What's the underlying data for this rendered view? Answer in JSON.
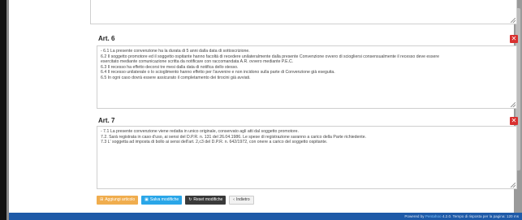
{
  "sections": [
    {
      "title": "Art. 6",
      "delete_icon": "close-icon",
      "lines": [
        "- 6.1 La presente convenzione ha la durata di 5 anni dalla data di sottoscrizione.",
        "6.2 Il soggetto promotore ed il soggetto ospitante hanno facoltà di recedere unilateralmente dalla presente Convenzione ovvero di sciogliersi consensualmente il recesso deve essere",
        "esercitato mediante comunicazione scritta da notificare con raccomandata A.R. ovvero mediante P.E.C.",
        "6.3 Il recesso ha effetto decorsi tre mesi dalla data di notifica dello stesso.",
        "6.4 Il recesso unilaterale o lo scioglimento hanno effetto per l'avvenire e non incidono sulla parte di Convenzione già eseguita.",
        "6.5 In ogni caso dovrà essere assicurato il completamento dei tirocini già avviati."
      ]
    },
    {
      "title": "Art. 7",
      "delete_icon": "close-icon",
      "lines": [
        "- 7.1 La presente convenzione viene redatta in unico originale, conservato agli atti dal soggetto promotore.",
        "7.2. Sarà registrata in caso d'uso, ai sensi del D.P.R. n. 131 del 26.04.1986. Le spese di registrazione saranno a carico della Parte richiedente.",
        "7.3 L' soggetta ad imposta di bollo ai sensi dell'art. 2,c3 del D.P.R. n. 642/1972, con onere a carico del soggetto ospitante."
      ]
    }
  ],
  "toolbar": {
    "add_label": "Aggiungi articolo",
    "save_label": "Salva modifiche",
    "reset_label": "Reset modifiche",
    "back_label": "Indietro"
  },
  "footer": {
    "prefix": "Powered by",
    "brand": "Pentahoo",
    "suffix": "4.2.0. Tempo di risposta per la pagina: 120 ms"
  }
}
